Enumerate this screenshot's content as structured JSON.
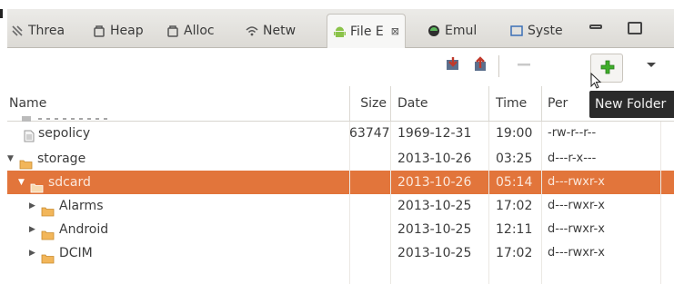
{
  "tabs": [
    {
      "label": "Threa",
      "icon": "threads-icon",
      "active": false
    },
    {
      "label": "Heap",
      "icon": "heap-icon",
      "active": false
    },
    {
      "label": "Alloc",
      "icon": "allocation-icon",
      "active": false
    },
    {
      "label": "Netw",
      "icon": "network-icon",
      "active": false
    },
    {
      "label": "File E",
      "icon": "android-icon",
      "active": true,
      "close": "⊠"
    },
    {
      "label": "Emul",
      "icon": "emulator-icon",
      "active": false
    },
    {
      "label": "Syste",
      "icon": "system-icon",
      "active": false
    }
  ],
  "toolbar": {
    "icons": [
      "pull-file-icon",
      "push-file-icon",
      "delete-icon",
      "new-folder-icon",
      "view-menu-icon"
    ]
  },
  "columns": {
    "name": "Name",
    "size": "Size",
    "date": "Date",
    "time": "Time",
    "permissions": "Per"
  },
  "tooltip": {
    "text": "New Folder"
  },
  "rows": [
    {
      "name": "sepolicy",
      "type": "file",
      "indent": 0,
      "arrow": "",
      "size": "63747",
      "date": "1969-12-31",
      "time": "19:00",
      "permissions": "-rw-r--r--"
    },
    {
      "name": "storage",
      "type": "folder",
      "indent": 0,
      "arrow": "▼",
      "size": "",
      "date": "2013-10-26",
      "time": "03:25",
      "permissions": "d---r-x---"
    },
    {
      "name": "sdcard",
      "type": "folder",
      "indent": 1,
      "arrow": "▼",
      "size": "",
      "date": "2013-10-26",
      "time": "05:14",
      "permissions": "d---rwxr-x",
      "selected": true
    },
    {
      "name": "Alarms",
      "type": "folder",
      "indent": 2,
      "arrow": "▶",
      "size": "",
      "date": "2013-10-25",
      "time": "17:02",
      "permissions": "d---rwxr-x"
    },
    {
      "name": "Android",
      "type": "folder",
      "indent": 2,
      "arrow": "▶",
      "size": "",
      "date": "2013-10-25",
      "time": "12:11",
      "permissions": "d---rwxr-x"
    },
    {
      "name": "DCIM",
      "type": "folder",
      "indent": 2,
      "arrow": "▶",
      "size": "",
      "date": "2013-10-25",
      "time": "17:02",
      "permissions": "d---rwxr-x"
    }
  ],
  "colors": {
    "selection": "#e2753b",
    "folder": "#f2b65a",
    "android_green": "#8bc34a",
    "plus_green": "#3fae2a"
  }
}
